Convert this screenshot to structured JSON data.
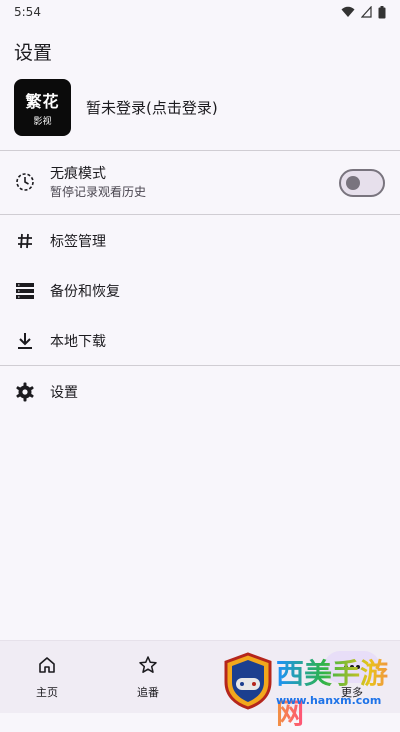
{
  "status": {
    "time": "5:54"
  },
  "page_title": "设置",
  "profile": {
    "avatar_line1": "繁花",
    "avatar_line2": "影视",
    "login_label": "暂未登录(点击登录)"
  },
  "incognito": {
    "title": "无痕模式",
    "subtitle": "暂停记录观看历史",
    "enabled": false
  },
  "menu": [
    {
      "label": "标签管理",
      "icon": "hash-icon"
    },
    {
      "label": "备份和恢复",
      "icon": "storage-icon"
    },
    {
      "label": "本地下载",
      "icon": "download-icon"
    }
  ],
  "settings_item": {
    "label": "设置",
    "icon": "gear-icon"
  },
  "bottom_nav": [
    {
      "label": "主页",
      "icon": "home-icon"
    },
    {
      "label": "追番",
      "icon": "star-icon"
    },
    {
      "label": "",
      "icon": "search-icon"
    },
    {
      "label": "更多",
      "icon": "more-icon",
      "active": true
    }
  ],
  "watermark": {
    "title": "西美手游网",
    "url": "www.hanxm.com"
  },
  "colors": {
    "background": "#f8f6fb",
    "nav_background": "#f0ecf4",
    "active_pill": "#e8def8",
    "accent": "#79747e"
  }
}
